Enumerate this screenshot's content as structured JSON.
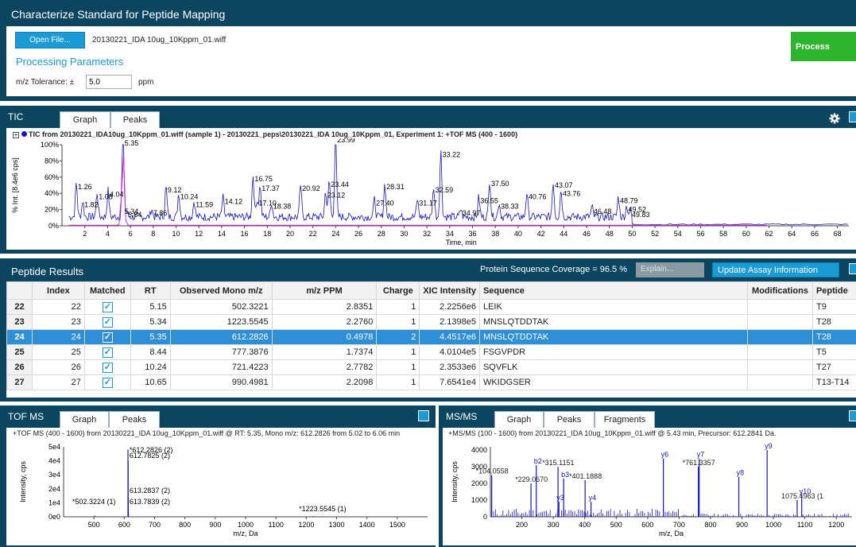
{
  "header": {
    "title": "Characterize Standard for Peptide Mapping",
    "open_file_label": "Open File...",
    "file_name": "20130221_IDA 10ug_10Kppm_01.wiff",
    "processing_params_label": "Processing Parameters",
    "tolerance_label": "m/z Tolerance: ±",
    "tolerance_value": "5.0",
    "tolerance_unit": "ppm",
    "process_label": "Process"
  },
  "tic": {
    "title": "TIC",
    "tabs": [
      "Graph",
      "Peaks"
    ],
    "description": "TIC from 20130221_IDA10ug_10Kppm_01.wiff (sample 1) - 20130221_peps\\20130221_IDA 10ug_10Kppm_01, Experiment 1: +TOF MS (400 - 1600)",
    "ylabel": "% Int. [8.4e6 cps]",
    "xlabel": "Time, min",
    "yticks": [
      "100%",
      "80%",
      "60%",
      "40%",
      "20%",
      "0%"
    ]
  },
  "peptide_results": {
    "title": "Peptide Results",
    "coverage": "Protein Sequence Coverage = 96.5 %",
    "explain_placeholder": "Explain...",
    "update_label": "Update Assay Information",
    "columns": [
      "Index",
      "Matched",
      "RT",
      "Observed Mono m/z",
      "m/z PPM",
      "Charge",
      "XIC Intensity",
      "Sequence",
      "Modifications",
      "Peptide"
    ],
    "rows": [
      {
        "row": "22",
        "index": "22",
        "rt": "5.15",
        "mz": "502.3221",
        "ppm": "2.8351",
        "charge": "1",
        "xic": "2.2256e6",
        "seq": "LEIK",
        "mods": "",
        "pep": "T9"
      },
      {
        "row": "23",
        "index": "23",
        "rt": "5.34",
        "mz": "1223.5545",
        "ppm": "2.2760",
        "charge": "1",
        "xic": "2.1398e5",
        "seq": "MNSLQTDDTAK",
        "mods": "",
        "pep": "T28"
      },
      {
        "row": "24",
        "index": "24",
        "rt": "5.35",
        "mz": "612.2826",
        "ppm": "0.4978",
        "charge": "2",
        "xic": "4.4517e6",
        "seq": "MNSLQTDDTAK",
        "mods": "",
        "pep": "T28"
      },
      {
        "row": "25",
        "index": "25",
        "rt": "8.44",
        "mz": "777.3876",
        "ppm": "1.7374",
        "charge": "1",
        "xic": "4.0104e5",
        "seq": "FSGVPDR",
        "mods": "",
        "pep": "T5"
      },
      {
        "row": "26",
        "index": "26",
        "rt": "10.24",
        "mz": "721.4223",
        "ppm": "2.7782",
        "charge": "1",
        "xic": "2.3533e6",
        "seq": "SQVFLK",
        "mods": "",
        "pep": "T27"
      },
      {
        "row": "27",
        "index": "27",
        "rt": "10.65",
        "mz": "990.4981",
        "ppm": "2.2098",
        "charge": "1",
        "xic": "7.6541e4",
        "seq": "WKIDGSER",
        "mods": "",
        "pep": "T13-T14"
      }
    ]
  },
  "tofms": {
    "title": "TOF MS",
    "tabs": [
      "Graph",
      "Peaks"
    ],
    "description": "+TOF MS (400 - 1600) from 20130221_IDA 10ug_10Kppm_01.wiff @ RT: 5.35, Mono m/z: 612.2826 from 5.02 to 6.06 min",
    "ylabel": "Intensity, cps",
    "xlabel": "m/z, Da"
  },
  "msms": {
    "title": "MS/MS",
    "tabs": [
      "Graph",
      "Peaks",
      "Fragments"
    ],
    "description": "+MS/MS (100 - 1600) from 20130221_IDA 10ug_10Kppm_01.wiff @ 5.43 min, Precursor: 612.2841 Da.",
    "ylabel": "Intensity, cps",
    "xlabel": "m/z, Da"
  },
  "chart_data": [
    {
      "type": "line",
      "xlabel": "Time, min",
      "ylabel": "% Int. [8.4e6 cps]",
      "xlim": [
        0,
        69
      ],
      "ylim": [
        0,
        100
      ],
      "xticks": [
        2,
        4,
        6,
        8,
        10,
        12,
        14,
        16,
        18,
        20,
        22,
        24,
        26,
        28,
        30,
        32,
        34,
        36,
        38,
        40,
        42,
        44,
        46,
        48,
        50,
        52,
        54,
        56,
        58,
        60,
        62,
        64,
        66,
        68
      ],
      "peaks": [
        {
          "x": 1.26,
          "y": 42,
          "label": "1.26"
        },
        {
          "x": 1.82,
          "y": 20,
          "label": "1.82"
        },
        {
          "x": 3.08,
          "y": 30,
          "label": "1.08"
        },
        {
          "x": 4.04,
          "y": 33,
          "label": "4.04"
        },
        {
          "x": 5.35,
          "y": 96,
          "label": "5.35"
        },
        {
          "x": 5.34,
          "y": 12,
          "label": "5.34"
        },
        {
          "x": 5.64,
          "y": 8,
          "label": "5.64"
        },
        {
          "x": 7.86,
          "y": 10,
          "label": "7.86"
        },
        {
          "x": 9.12,
          "y": 38,
          "label": "9.12"
        },
        {
          "x": 10.24,
          "y": 30,
          "label": "10.24"
        },
        {
          "x": 11.59,
          "y": 20,
          "label": "11.59"
        },
        {
          "x": 14.12,
          "y": 24,
          "label": "14.12"
        },
        {
          "x": 16.75,
          "y": 52,
          "label": "16.75"
        },
        {
          "x": 17.37,
          "y": 40,
          "label": "17.37"
        },
        {
          "x": 17.1,
          "y": 22,
          "label": "17.10"
        },
        {
          "x": 18.38,
          "y": 18,
          "label": "18.38"
        },
        {
          "x": 20.92,
          "y": 40,
          "label": "20.92"
        },
        {
          "x": 23.12,
          "y": 32,
          "label": "23.12"
        },
        {
          "x": 23.99,
          "y": 100,
          "label": "23.99"
        },
        {
          "x": 23.44,
          "y": 45,
          "label": "23.44"
        },
        {
          "x": 27.4,
          "y": 22,
          "label": "27.40"
        },
        {
          "x": 28.31,
          "y": 42,
          "label": "28.31"
        },
        {
          "x": 31.17,
          "y": 22,
          "label": "31.17"
        },
        {
          "x": 32.59,
          "y": 38,
          "label": "32.59"
        },
        {
          "x": 33.22,
          "y": 82,
          "label": "33.22"
        },
        {
          "x": 34.97,
          "y": 10,
          "label": "34.97"
        },
        {
          "x": 36.55,
          "y": 25,
          "label": "36.55"
        },
        {
          "x": 37.5,
          "y": 46,
          "label": "37.50"
        },
        {
          "x": 38.33,
          "y": 18,
          "label": "38.33"
        },
        {
          "x": 40.76,
          "y": 30,
          "label": "40.76"
        },
        {
          "x": 43.07,
          "y": 44,
          "label": "43.07"
        },
        {
          "x": 43.76,
          "y": 34,
          "label": "43.76"
        },
        {
          "x": 46.48,
          "y": 12,
          "label": "46.48"
        },
        {
          "x": 48.79,
          "y": 25,
          "label": "48.79"
        },
        {
          "x": 49.52,
          "y": 14,
          "label": "49.52"
        },
        {
          "x": 49.83,
          "y": 8,
          "label": "49.83"
        }
      ],
      "xic_trace_color": "#d62bd6",
      "tic_trace_color": "#1515c8"
    },
    {
      "type": "bar",
      "xlabel": "m/z, Da",
      "ylabel": "Intensity, cps",
      "xlim": [
        400,
        1600
      ],
      "ylim": [
        0,
        50000
      ],
      "yticks": [
        "5e4",
        "4e4",
        "3e4",
        "2e4",
        "1e4",
        "0e0"
      ],
      "xticks": [
        500,
        600,
        700,
        800,
        900,
        1000,
        1100,
        1200,
        1300,
        1400,
        1500
      ],
      "peaks": [
        {
          "x": 502.3224,
          "y": 800,
          "label": "*502.3224 (1)"
        },
        {
          "x": 612.2826,
          "y": 48000,
          "label": "*612.2826 (2)"
        },
        {
          "x": 612.7825,
          "y": 40000,
          "label": "612.7825 (2)"
        },
        {
          "x": 613.2837,
          "y": 14000,
          "label": "613.2837 (2)"
        },
        {
          "x": 613.7839,
          "y": 3500,
          "label": "613.7839 (2)"
        },
        {
          "x": 1223.5545,
          "y": 500,
          "label": "*1223.5545 (1)"
        }
      ]
    },
    {
      "type": "bar",
      "xlabel": "m/z, Da",
      "ylabel": "Intensity, cps",
      "xlim": [
        100,
        1250
      ],
      "ylim": [
        0,
        4200
      ],
      "yticks": [
        "4000",
        "3000",
        "2000",
        "1000",
        "0"
      ],
      "xticks": [
        200,
        300,
        400,
        500,
        600,
        700,
        800,
        900,
        1000,
        1100,
        1200
      ],
      "peaks": [
        {
          "x": 104.0558,
          "y": 2500,
          "label": "*104.0558"
        },
        {
          "x": 229.067,
          "y": 2000,
          "label": "*229.0670"
        },
        {
          "x": 246,
          "y": 3100,
          "label": "b2"
        },
        {
          "x": 315.1151,
          "y": 3000,
          "label": "*315.1151"
        },
        {
          "x": 333,
          "y": 2300,
          "label": "b3"
        },
        {
          "x": 401.1888,
          "y": 2200,
          "label": "*401.1888"
        },
        {
          "x": 318,
          "y": 900,
          "label": "y3"
        },
        {
          "x": 420,
          "y": 900,
          "label": "y4"
        },
        {
          "x": 650,
          "y": 3500,
          "label": "y6"
        },
        {
          "x": 761.3357,
          "y": 3000,
          "label": "*761.3357"
        },
        {
          "x": 764,
          "y": 3500,
          "label": "y7"
        },
        {
          "x": 890,
          "y": 2400,
          "label": "y8"
        },
        {
          "x": 980,
          "y": 4000,
          "label": "y9"
        },
        {
          "x": 1075.4963,
          "y": 1000,
          "label": "1075.4963 (1"
        },
        {
          "x": 1090,
          "y": 1300,
          "label": "y10"
        }
      ]
    }
  ]
}
